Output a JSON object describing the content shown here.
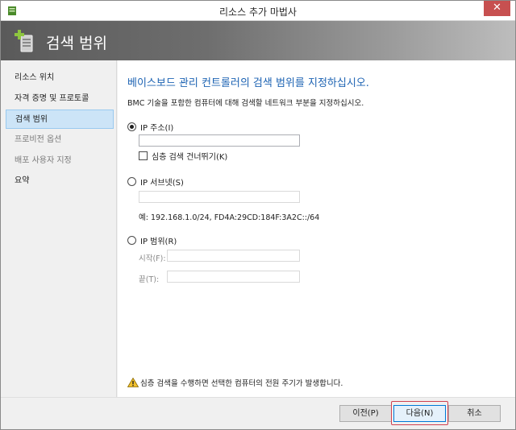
{
  "window": {
    "title": "리소스 추가 마법사",
    "close_glyph": "✕"
  },
  "banner": {
    "title": "검색 범위",
    "icon": "add-resource-icon"
  },
  "nav": {
    "items": [
      {
        "label": "리소스 위치",
        "state": "normal"
      },
      {
        "label": "자격 증명 및 프로토콜",
        "state": "normal"
      },
      {
        "label": "검색 범위",
        "state": "selected"
      },
      {
        "label": "프로비전 옵션",
        "state": "disabled"
      },
      {
        "label": "배포 사용자 지정",
        "state": "disabled"
      },
      {
        "label": "요약",
        "state": "normal"
      }
    ]
  },
  "main": {
    "heading": "베이스보드 관리 컨트롤러의 검색 범위를 지정하십시오.",
    "subtext": "BMC 기술을 포함한 컴퓨터에 대해 검색할 네트워크 부분을 지정하십시오.",
    "ip_address": {
      "label": "IP 주소(I)",
      "selected": true,
      "value": "",
      "deep_scan_label": "심층 검색 건너뛰기(K)",
      "deep_scan_checked": false
    },
    "ip_subnet": {
      "label": "IP 서브넷(S)",
      "selected": false,
      "value": "",
      "example": "예: 192.168.1.0/24, FD4A:29CD:184F:3A2C::/64"
    },
    "ip_range": {
      "label": "IP 범위(R)",
      "selected": false,
      "start_label": "시작(F):",
      "start_value": "",
      "end_label": "끝(T):",
      "end_value": ""
    },
    "warning": "심층 검색을 수행하면 선택한 컴퓨터의 전원 주기가 발생합니다."
  },
  "buttons": {
    "previous": "이전(P)",
    "next": "다음(N)",
    "cancel": "취소"
  },
  "colors": {
    "accent": "#1d63b3",
    "selection": "#cce4f7",
    "highlight": "#d04050"
  }
}
